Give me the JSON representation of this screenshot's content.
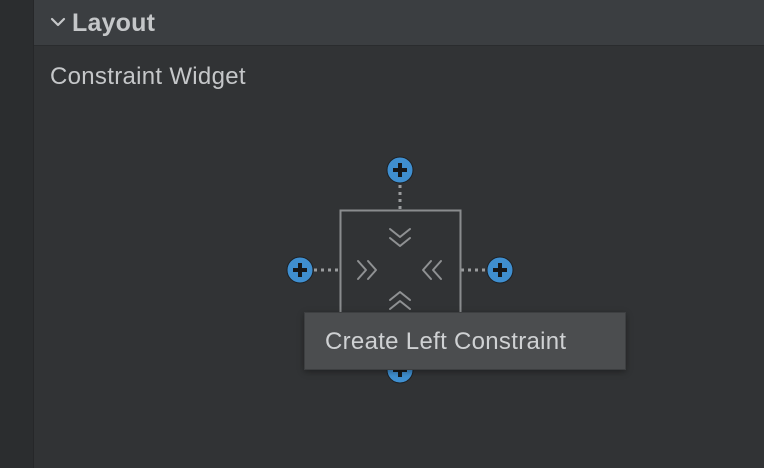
{
  "section": {
    "title": "Layout",
    "expanded": true,
    "chevron_icon": "chevron-down-icon"
  },
  "widget": {
    "title": "Constraint Widget"
  },
  "constraint_handles": {
    "top_icon": "add-circle-icon",
    "left_icon": "add-circle-icon",
    "right_icon": "add-circle-icon",
    "bottom_icon": "add-circle-icon"
  },
  "tooltip": {
    "text": "Create Left Constraint"
  },
  "colors": {
    "accent": "#3f8fd0",
    "panel_bg": "#313335",
    "header_bg": "#3b3e41",
    "text": "#c5c7c9"
  }
}
